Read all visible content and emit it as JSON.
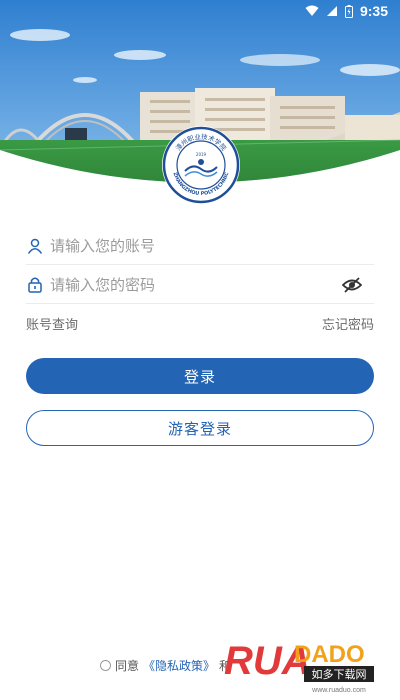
{
  "status_bar": {
    "time": "9:35"
  },
  "logo": {
    "seal_text_top": "漳州职业技术学院",
    "seal_text_bottom": "ZHANGZHOU POLYTECHNIC",
    "seal_year": "2019"
  },
  "form": {
    "account_placeholder": "请输入您的账号",
    "password_placeholder": "请输入您的密码",
    "account_lookup": "账号查询",
    "forgot_password": "忘记密码",
    "login_button": "登录",
    "guest_button": "游客登录"
  },
  "agreement": {
    "prefix": "同意",
    "policy": "《隐私政策》",
    "suffix": "和"
  },
  "watermark": {
    "brand": "RUADADO",
    "site_cn": "如多下载网",
    "site_url": "www.ruaduo.com"
  },
  "colors": {
    "primary": "#2464b4",
    "sky": "#3f8fd8",
    "grass": "#2f8a3a"
  }
}
